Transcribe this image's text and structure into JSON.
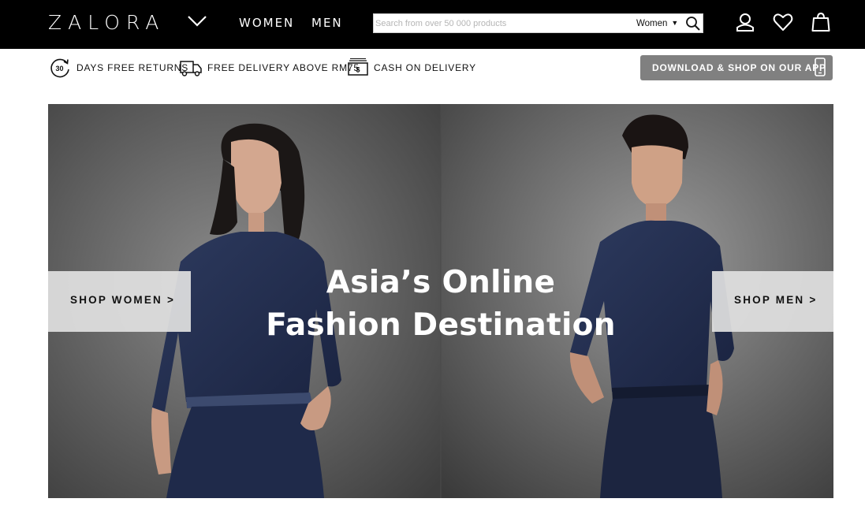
{
  "header": {
    "logo": "ZALORA",
    "nav": {
      "women": "WOMEN",
      "men": "MEN"
    },
    "search": {
      "placeholder": "Search from over 50 000 products",
      "value": "",
      "category": "Women"
    },
    "icons": {
      "account": "account-icon",
      "wishlist": "heart-icon",
      "bag": "shopping-bag-icon"
    }
  },
  "usp": {
    "returns_badge": "30",
    "returns": "DAYS FREE RETURNS",
    "delivery": "FREE DELIVERY ABOVE RM75",
    "cod_symbol": "$",
    "cod": "CASH ON DELIVERY"
  },
  "app_button": {
    "label": "DOWNLOAD & SHOP ON OUR APP"
  },
  "hero": {
    "title_line1": "Asia’s Online",
    "title_line2": "Fashion Destination",
    "shop_women": "SHOP WOMEN >",
    "shop_men": "SHOP MEN >"
  },
  "colors": {
    "topbar": "#000000",
    "app_button": "#808080",
    "denim": "#1f2a4a",
    "hero_bg": "#5a5a5a"
  }
}
